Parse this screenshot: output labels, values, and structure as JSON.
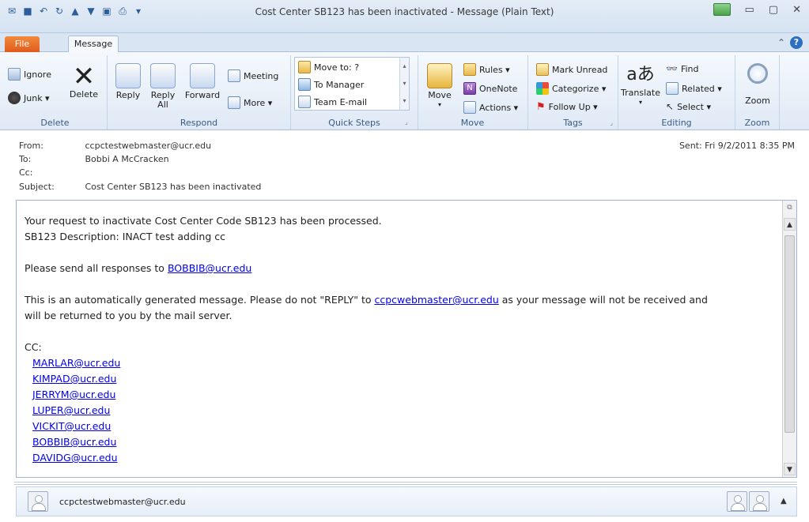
{
  "window": {
    "title": "Cost Center SB123 has been inactivated  -  Message (Plain Text)"
  },
  "tabs": {
    "file": "File",
    "message": "Message"
  },
  "ribbon": {
    "delete_group": {
      "label": "Delete",
      "ignore": "Ignore",
      "junk": "Junk ▾",
      "delete": "Delete"
    },
    "respond_group": {
      "label": "Respond",
      "reply": "Reply",
      "reply_all_1": "Reply",
      "reply_all_2": "All",
      "forward": "Forward",
      "meeting": "Meeting",
      "more": "More ▾"
    },
    "quicksteps_group": {
      "label": "Quick Steps",
      "items": [
        "Move to: ?",
        "To Manager",
        "Team E-mail"
      ]
    },
    "move_group": {
      "label": "Move",
      "move": "Move",
      "rules": "Rules ▾",
      "onenote": "OneNote",
      "actions": "Actions ▾"
    },
    "tags_group": {
      "label": "Tags",
      "mark_unread": "Mark Unread",
      "categorize": "Categorize ▾",
      "follow_up": "Follow Up ▾"
    },
    "editing_group": {
      "label": "Editing",
      "translate": "Translate",
      "find": "Find",
      "related": "Related ▾",
      "select": "Select ▾"
    },
    "zoom_group": {
      "label": "Zoom",
      "zoom": "Zoom"
    }
  },
  "header": {
    "from_label": "From:",
    "from": "ccpctestwebmaster@ucr.edu",
    "to_label": "To:",
    "to": "Bobbi A McCracken",
    "cc_label": "Cc:",
    "subject_label": "Subject:",
    "subject": "Cost Center SB123 has been inactivated",
    "sent": "Sent:   Fri 9/2/2011 8:35 PM"
  },
  "body": {
    "line1": "Your request to inactivate Cost Center Code SB123 has been processed.",
    "line2": "SB123 Description: INACT test adding cc",
    "responses_prefix": "Please send all responses to ",
    "responses_link": "BOBBIB@ucr.edu",
    "auto_prefix": "This is an automatically generated message. Please do not \"REPLY\" to ",
    "auto_link": "ccpcwebmaster@ucr.edu",
    "auto_suffix": " as your message will not be received and",
    "auto_line2": "will be returned to you by the mail server.",
    "cc_label": "CC:",
    "cc_list": [
      "MARLAR@ucr.edu",
      "KIMPAD@ucr.edu",
      "JERRYM@ucr.edu",
      "LUPER@ucr.edu",
      "VICKIT@ucr.edu",
      "BOBBIB@ucr.edu",
      "DAVIDG@ucr.edu"
    ]
  },
  "people_pane": {
    "sender": "ccpctestwebmaster@ucr.edu",
    "expand": "▲"
  }
}
